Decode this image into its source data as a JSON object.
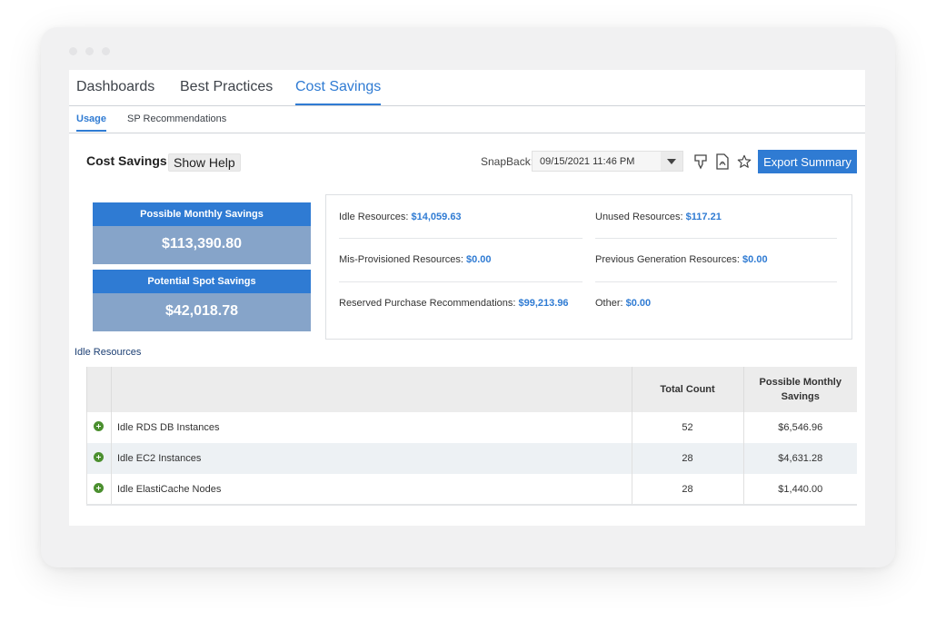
{
  "tabs": [
    {
      "label": "Dashboards",
      "active": false
    },
    {
      "label": "Best Practices",
      "active": false
    },
    {
      "label": "Cost Savings",
      "active": true
    }
  ],
  "subtabs": [
    {
      "label": "Usage",
      "active": true
    },
    {
      "label": "SP Recommendations",
      "active": false
    }
  ],
  "toolbar": {
    "title": "Cost Savings",
    "help_label": "Show Help",
    "snapback_label": "SnapBack:",
    "snapback_value": "09/15/2021 11:46 PM",
    "export_label": "Export Summary",
    "icons": [
      "download-icon",
      "pdf-icon",
      "star-icon"
    ]
  },
  "cards": [
    {
      "label": "Possible Monthly Savings",
      "value": "$113,390.80"
    },
    {
      "label": "Potential Spot Savings",
      "value": "$42,018.78"
    }
  ],
  "summary": [
    {
      "label": "Idle Resources:",
      "value": "$14,059.63"
    },
    {
      "label": "Unused Resources:",
      "value": "$117.21"
    },
    {
      "label": "Mis-Provisioned Resources:",
      "value": "$0.00"
    },
    {
      "label": "Previous Generation Resources:",
      "value": "$0.00"
    },
    {
      "label": "Reserved Purchase Recommendations:",
      "value": "$99,213.96"
    },
    {
      "label": "Other:",
      "value": "$0.00"
    }
  ],
  "section_label": "Idle Resources",
  "table": {
    "columns": [
      "",
      "",
      "Total Count",
      "Possible Monthly Savings"
    ],
    "rows": [
      {
        "name": "Idle RDS DB Instances",
        "count": "52",
        "savings": "$6,546.96"
      },
      {
        "name": "Idle EC2 Instances",
        "count": "28",
        "savings": "$4,631.28"
      },
      {
        "name": "Idle ElastiCache Nodes",
        "count": "28",
        "savings": "$1,440.00"
      }
    ]
  },
  "colors": {
    "accent": "#2f7bd3",
    "card_value_bg": "#86a4c9",
    "expand_icon": "#4b8f2f"
  }
}
